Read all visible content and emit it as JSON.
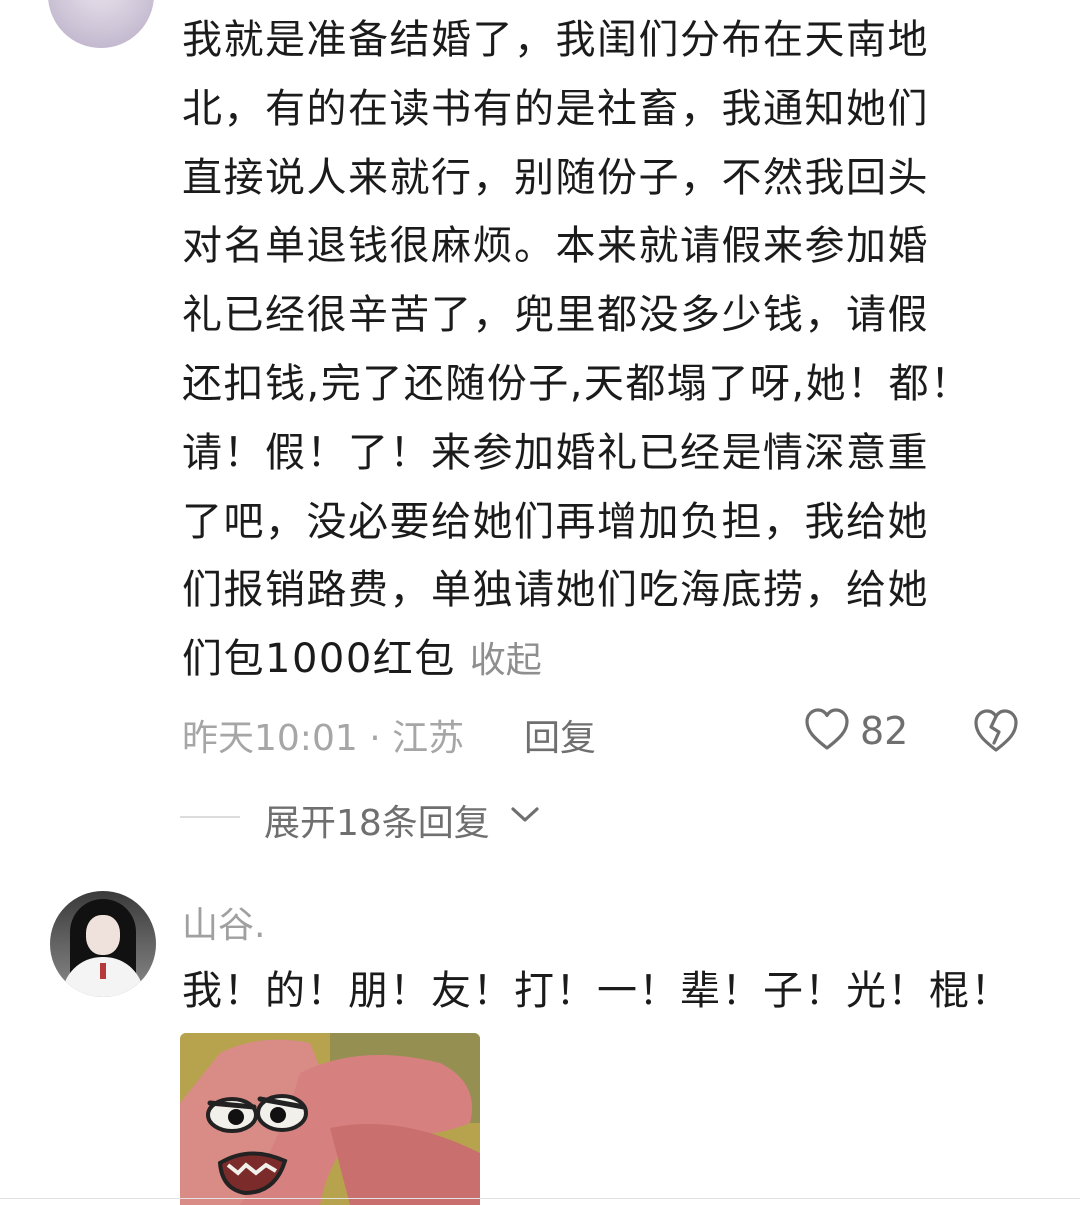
{
  "comment1": {
    "lines": [
      "我就是准备结婚了，我闺们分布在天南地",
      "北，有的在读书有的是社畜，我通知她们",
      "直接说人来就行，别随份子，不然我回头",
      "对名单退钱很麻烦。本来就请假来参加婚",
      "礼已经很辛苦了，兜里都没多少钱，请假",
      "还扣钱,完了还随份子,天都塌了呀,她！都！",
      "请！假！了！来参加婚礼已经是情深意重",
      "了吧，没必要给她们再增加负担，我给她",
      "们报销路费，单独请她们吃海底捞，给她",
      "们包1000红包"
    ],
    "collapse_label": "收起",
    "time_location": "昨天10:01 · 江苏",
    "reply_label": "回复",
    "like_count": "82",
    "expand_replies_label": "展开18条回复"
  },
  "comment2": {
    "username": "山谷.",
    "text": "我！的！朋！友！打！一！辈！子！光！棍！"
  }
}
